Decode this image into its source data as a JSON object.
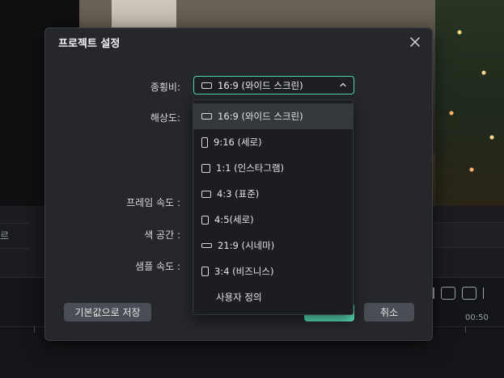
{
  "background": {
    "left_strip_text": "르",
    "timecode": "00:50"
  },
  "dialog": {
    "title": "프로젝트 설정",
    "labels": {
      "aspect_ratio": "종횡비:",
      "resolution": "해상도:",
      "frame_rate": "프레임 속도 :",
      "color_space": "색 공간 :",
      "sample_rate": "샘플 속도 :"
    },
    "aspect_ratio_value": "16:9 (와이드 스크린)",
    "buttons": {
      "reset": "기본값으로 저장",
      "ok": "",
      "cancel": "취소"
    }
  },
  "dropdown": {
    "selected_index": 0,
    "options": [
      {
        "label": "16:9 (와이드 스크린)",
        "icon": "landscape-ratio-icon"
      },
      {
        "label": "9:16 (세로)",
        "icon": "portrait-ratio-icon"
      },
      {
        "label": "1:1 (인스타그램)",
        "icon": "square-ratio-icon"
      },
      {
        "label": "4:3 (표준)",
        "icon": "standard-ratio-icon"
      },
      {
        "label": "4:5(세로)",
        "icon": "vertical-ratio-icon"
      },
      {
        "label": "21:9 (시네마)",
        "icon": "cinema-ratio-icon"
      },
      {
        "label": "3:4 (비즈니스)",
        "icon": "business-ratio-icon"
      },
      {
        "label": "사용자 정의",
        "icon": ""
      }
    ]
  },
  "colors": {
    "accent": "#4fd6b4",
    "dialog_bg": "#25272b",
    "dropdown_bg": "#1c1d20",
    "selected_bg": "#35383d"
  }
}
